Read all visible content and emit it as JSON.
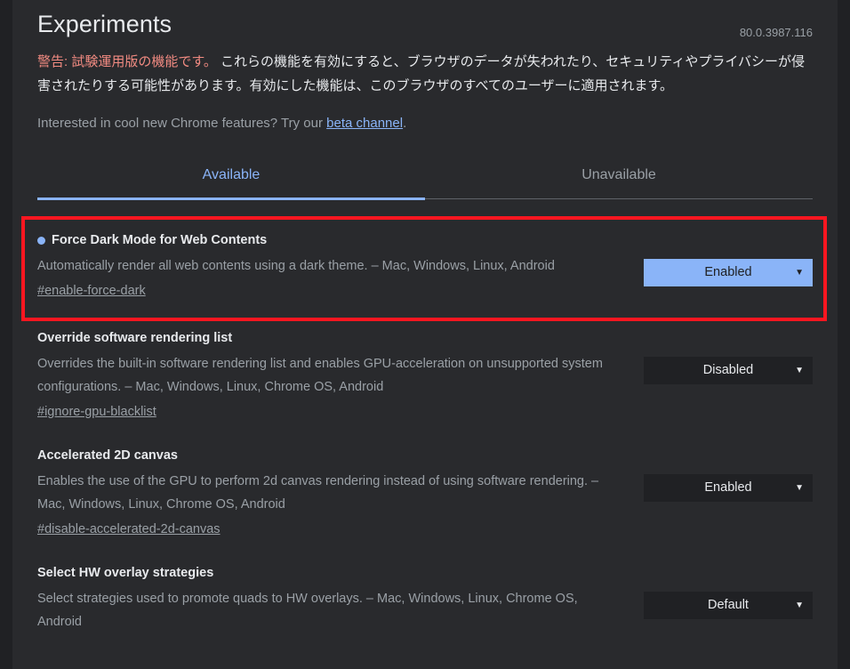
{
  "header": {
    "title": "Experiments",
    "version": "80.0.3987.116"
  },
  "warning": {
    "lead": "警告: 試験運用版の機能です。",
    "body": " これらの機能を有効にすると、ブラウザのデータが失われたり、セキュリティやプライバシーが侵害されたりする可能性があります。有効にした機能は、このブラウザのすべてのユーザーに適用されます。"
  },
  "beta_note": {
    "prefix": "Interested in cool new Chrome features? Try our ",
    "link_label": "beta channel",
    "suffix": "."
  },
  "tabs": [
    {
      "label": "Available",
      "active": true
    },
    {
      "label": "Unavailable",
      "active": false
    }
  ],
  "colors": {
    "accent_blue": "#8ab4f8",
    "warning_red": "#f28b82",
    "highlight_box": "#fb1620",
    "surface": "#292a2d",
    "page_bg": "#202124",
    "text_primary": "#e8eaed",
    "text_secondary": "#9aa0a6"
  },
  "experiments": [
    {
      "title": "Force Dark Mode for Web Contents",
      "description": "Automatically render all web contents using a dark theme. – Mac, Windows, Linux, Android",
      "hash": "#enable-force-dark",
      "value": "Enabled",
      "modified": true,
      "highlighted": true,
      "caret": "▼"
    },
    {
      "title": "Override software rendering list",
      "description": "Overrides the built-in software rendering list and enables GPU-acceleration on unsupported system configurations. – Mac, Windows, Linux, Chrome OS, Android",
      "hash": "#ignore-gpu-blacklist",
      "value": "Disabled",
      "modified": false,
      "highlighted": false,
      "caret": "▼"
    },
    {
      "title": "Accelerated 2D canvas",
      "description": "Enables the use of the GPU to perform 2d canvas rendering instead of using software rendering. – Mac, Windows, Linux, Chrome OS, Android",
      "hash": "#disable-accelerated-2d-canvas",
      "value": "Enabled",
      "modified": false,
      "highlighted": false,
      "caret": "▼"
    },
    {
      "title": "Select HW overlay strategies",
      "description": "Select strategies used to promote quads to HW overlays. – Mac, Windows, Linux, Chrome OS, Android",
      "hash": "",
      "value": "Default",
      "modified": false,
      "highlighted": false,
      "caret": "▼"
    }
  ]
}
